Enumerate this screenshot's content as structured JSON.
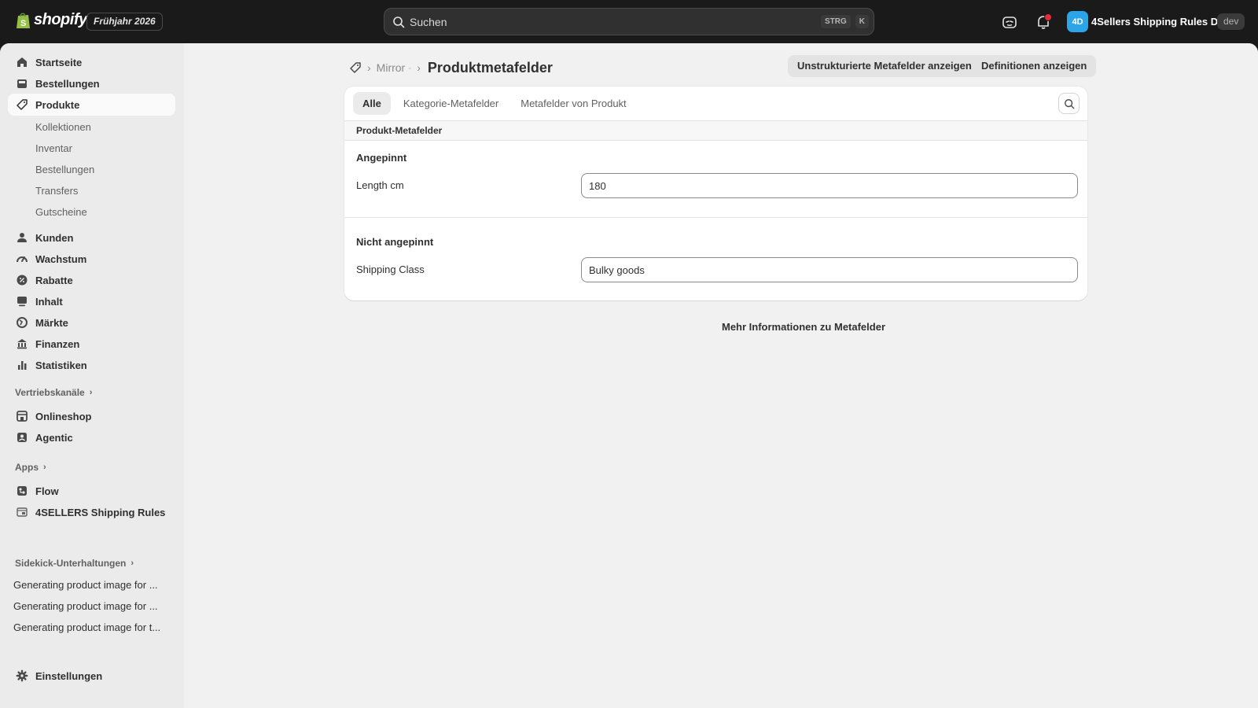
{
  "topbar": {
    "brand": "shopify",
    "edition": "Frühjahr 2026",
    "search_placeholder": "Suchen",
    "shortcut_1": "STRG",
    "shortcut_2": "K",
    "notification_count": "1",
    "avatar_initials": "4D",
    "store_name": "4Sellers Shipping Rules D...",
    "env_badge": "dev"
  },
  "sidebar": {
    "items": [
      {
        "label": "Startseite",
        "icon": "home-icon"
      },
      {
        "label": "Bestellungen",
        "icon": "inbox-icon"
      },
      {
        "label": "Produkte",
        "icon": "tag-icon"
      }
    ],
    "product_subitems": [
      "Kollektionen",
      "Inventar",
      "Bestellungen",
      "Transfers",
      "Gutscheine"
    ],
    "items2": [
      {
        "label": "Kunden",
        "icon": "person-icon"
      },
      {
        "label": "Wachstum",
        "icon": "gauge-icon"
      },
      {
        "label": "Rabatte",
        "icon": "discount-icon"
      },
      {
        "label": "Inhalt",
        "icon": "content-icon"
      },
      {
        "label": "Märkte",
        "icon": "globe-icon"
      },
      {
        "label": "Finanzen",
        "icon": "bank-icon"
      },
      {
        "label": "Statistiken",
        "icon": "bar-chart-icon"
      }
    ],
    "sales_channels_label": "Vertriebskanäle",
    "sales_channels": [
      {
        "label": "Onlineshop",
        "icon": "store-icon"
      },
      {
        "label": "Agentic",
        "icon": "agentic-icon"
      }
    ],
    "apps_label": "Apps",
    "apps": [
      {
        "label": "Flow",
        "icon": "flow-icon"
      },
      {
        "label": "4SELLERS Shipping Rules",
        "icon": "app-icon"
      }
    ],
    "sidekick_label": "Sidekick-Unterhaltungen",
    "sidekick_history": [
      "Generating product image for ...",
      "Generating product image for ...",
      "Generating product image for t..."
    ],
    "settings_label": "Einstellungen"
  },
  "main": {
    "breadcrumb_parent": "Mirror",
    "title": "Produktmetafelder",
    "btn_unstructured": "Unstrukturierte Metafelder anzeigen",
    "btn_definitions": "Definitionen anzeigen",
    "tabs": [
      "Alle",
      "Kategorie-Metafelder",
      "Metafelder von Produkt"
    ],
    "active_tab": "Alle",
    "section_title": "Produkt-Metafelder",
    "pinned_title": "Angepinnt",
    "pinned_fields": [
      {
        "label": "Length cm",
        "value": "180"
      }
    ],
    "unpinned_title": "Nicht angepinnt",
    "unpinned_fields": [
      {
        "label": "Shipping Class",
        "value": "Bulky goods"
      }
    ],
    "more_info": "Mehr Informationen zu Metafelder"
  },
  "colors": {
    "topbar_bg": "#1a1a1a",
    "sidebar_bg": "#ebebeb",
    "main_bg": "#f1f1f1",
    "avatar_bg": "#2ba5e8",
    "notification": "#e22c38"
  }
}
